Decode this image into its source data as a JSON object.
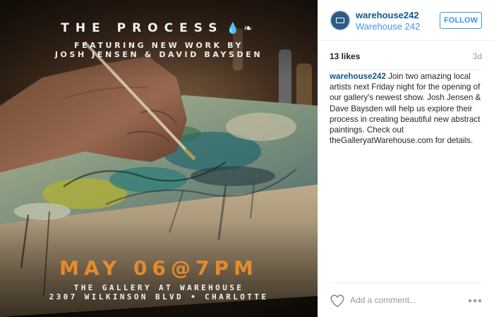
{
  "post": {
    "title": "THE PROCESS",
    "subtitle_1": "FEATURING NEW WORK BY",
    "subtitle_2": "JOSH JENSEN & DAVID BAYSDEN",
    "date": "MAY 06@7PM",
    "venue_1": "THE GALLERY AT WAREHOUSE",
    "venue_2": "2307 WILKINSON BLVD • CHARLOTTE"
  },
  "header": {
    "username": "warehouse242",
    "location": "Warehouse 242",
    "follow_label": "FOLLOW"
  },
  "stats": {
    "likes": "13 likes",
    "age": "3d"
  },
  "caption": {
    "username": "warehouse242",
    "text": "Join two amazing local artists next Friday night for the opening of our gallery's newest show. Josh Jensen & Dave Baysden will help us explore their process in creating beautiful new abstract paintings. Check out theGalleryatWarehouse.com for details."
  },
  "comment": {
    "placeholder": "Add a comment..."
  },
  "icons": {
    "heart": "heart-icon",
    "more": "more-options-icon",
    "avatar": "warehouse-logo-icon"
  },
  "colors": {
    "date_accent": "#e58a2b",
    "link_blue": "#125688",
    "follow_blue": "#3897f0"
  }
}
